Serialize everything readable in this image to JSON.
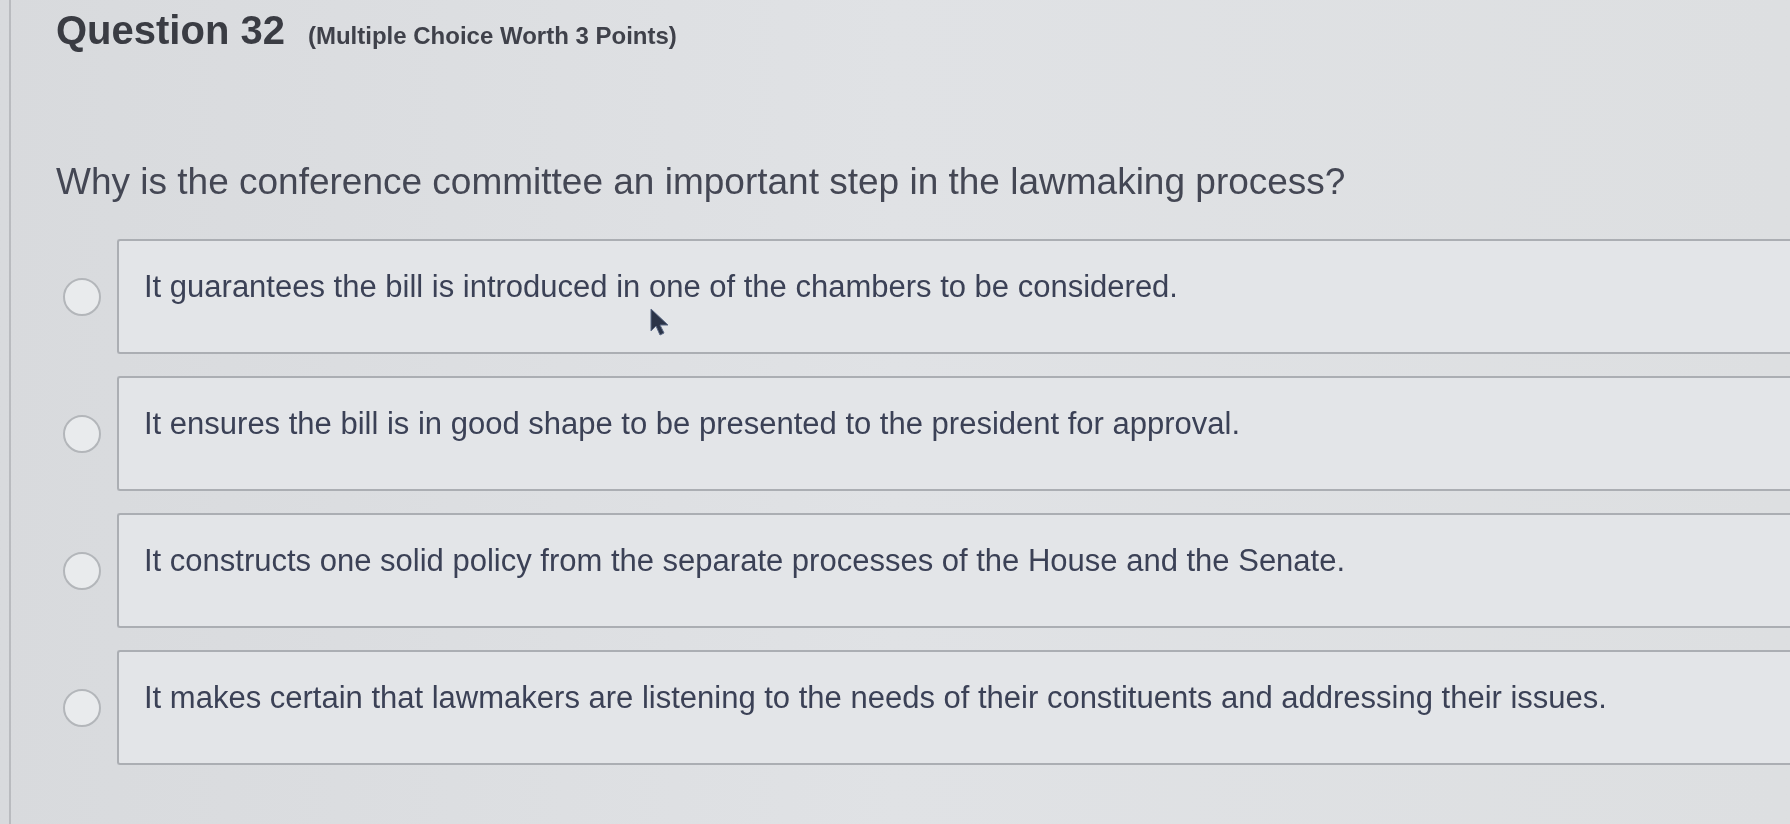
{
  "question": {
    "number": "Question 32",
    "type_label": "(Multiple Choice Worth 3 Points)",
    "prompt": "Why is the conference committee an important step in the lawmaking process?"
  },
  "options": [
    {
      "label": "It guarantees the bill is introduced in one of the chambers to be considered.",
      "selected": false
    },
    {
      "label": "It ensures the bill is in good shape to be presented to the president for approval.",
      "selected": false
    },
    {
      "label": "It constructs one solid policy from the separate processes of the House and the Senate.",
      "selected": false
    },
    {
      "label": "It makes certain that lawmakers are listening to the needs of their constituents and addressing their issues.",
      "selected": false
    }
  ]
}
